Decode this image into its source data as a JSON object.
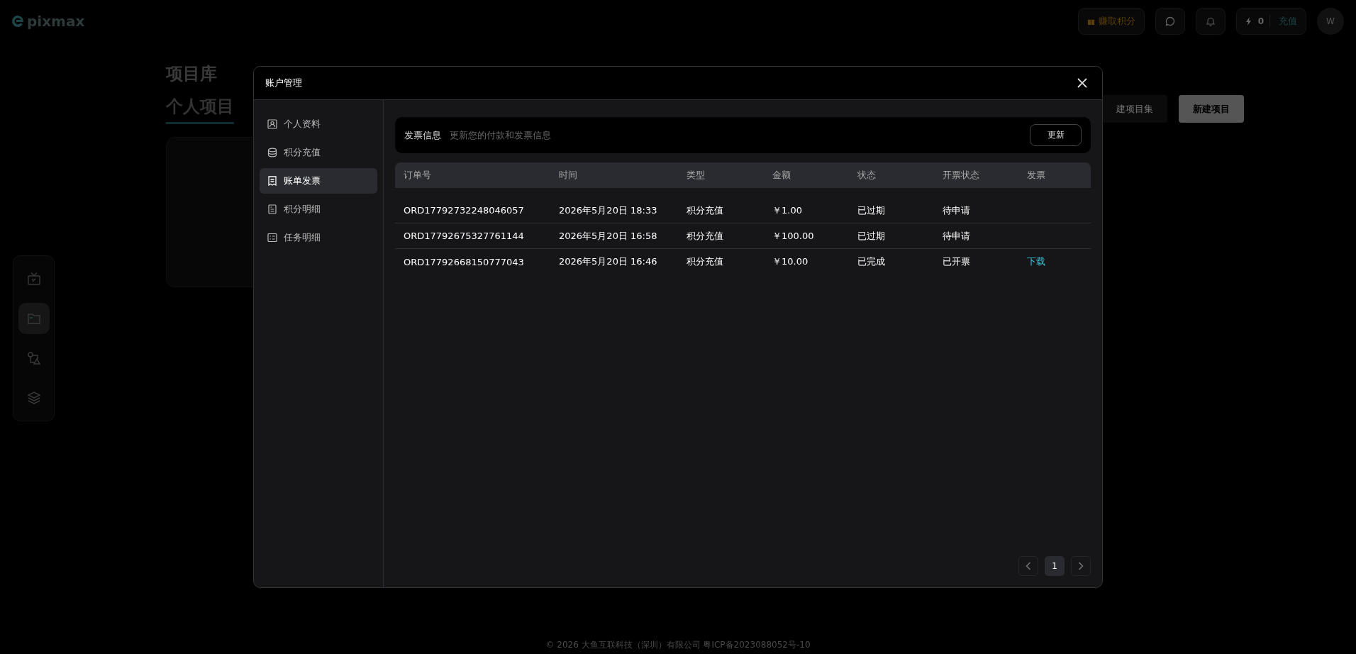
{
  "header": {
    "logo": "pixmax",
    "earn_button": "赚取积分",
    "credits": "0",
    "recharge": "充值",
    "avatar": "W"
  },
  "rail": [
    {
      "kind": "tv",
      "selected": false
    },
    {
      "kind": "folder",
      "selected": true
    },
    {
      "kind": "shapes",
      "selected": false
    },
    {
      "kind": "layers",
      "selected": false
    }
  ],
  "page": {
    "title": "项目库",
    "tabs": [
      {
        "label": "个人项目",
        "selected": true
      }
    ],
    "buttons": [
      "建项目集",
      "新建项目"
    ]
  },
  "modal": {
    "title": "账户管理",
    "nav": [
      {
        "label": "个人资料",
        "kind": "profile",
        "selected": false
      },
      {
        "label": "积分充值",
        "kind": "coins",
        "selected": false
      },
      {
        "label": "账单发票",
        "kind": "receipt",
        "selected": true
      },
      {
        "label": "积分明细",
        "kind": "document",
        "selected": false
      },
      {
        "label": "任务明细",
        "kind": "checklist",
        "selected": false
      }
    ],
    "invoice_bar": {
      "title": "发票信息",
      "description": "更新您的付款和发票信息",
      "button": "更新"
    },
    "table": {
      "columns": [
        "订单号",
        "时间",
        "类型",
        "金额",
        "状态",
        "开票状态",
        "发票"
      ],
      "rows": [
        {
          "order": "ORD17792732248046057",
          "time": "2026年5月20日 18:33",
          "type": "积分充值",
          "amount": "￥1.00",
          "status": "已过期",
          "invoice_status": "待申请"
        },
        {
          "order": "ORD17792675327761144",
          "time": "2026年5月20日 16:58",
          "type": "积分充值",
          "amount": "￥100.00",
          "status": "已过期",
          "invoice_status": "待申请"
        },
        {
          "order": "ORD17792668150777043",
          "time": "2026年5月20日 16:46",
          "type": "积分充值",
          "amount": "￥10.00",
          "status": "已完成",
          "invoice_status": "已开票",
          "invoice": "下载"
        }
      ]
    },
    "pagination": {
      "pages": [
        {
          "label": "1",
          "selected": true
        }
      ]
    }
  },
  "footer": "© 2026 大鱼互联科技（深圳）有限公司 粤ICP备2023088052号-10"
}
